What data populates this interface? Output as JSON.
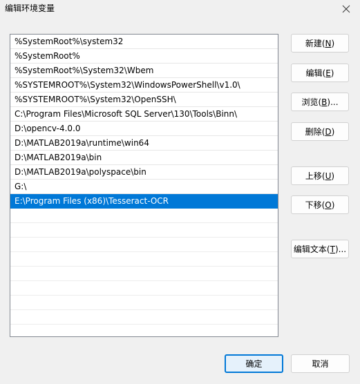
{
  "window": {
    "title": "编辑环境变量"
  },
  "path_list": {
    "items": [
      "%SystemRoot%\\system32",
      "%SystemRoot%",
      "%SystemRoot%\\System32\\Wbem",
      "%SYSTEMROOT%\\System32\\WindowsPowerShell\\v1.0\\",
      "%SYSTEMROOT%\\System32\\OpenSSH\\",
      "C:\\Program Files\\Microsoft SQL Server\\130\\Tools\\Binn\\",
      "D:\\opencv-4.0.0",
      "D:\\MATLAB2019a\\runtime\\win64",
      "D:\\MATLAB2019a\\bin",
      "D:\\MATLAB2019a\\polyspace\\bin",
      "G:\\",
      "E:\\Program Files (x86)\\Tesseract-OCR"
    ],
    "selected_index": 11
  },
  "buttons": {
    "new": {
      "label": "新建",
      "key": "N"
    },
    "edit": {
      "label": "编辑",
      "key": "E"
    },
    "browse": {
      "label": "浏览",
      "key": "B",
      "suffix": "..."
    },
    "delete": {
      "label": "删除",
      "key": "D"
    },
    "move_up": {
      "label": "上移",
      "key": "U"
    },
    "move_down": {
      "label": "下移",
      "key": "O"
    },
    "edit_text": {
      "label": "编辑文本",
      "key": "T",
      "suffix": "..."
    },
    "ok": "确定",
    "cancel": "取消"
  },
  "colors": {
    "selection": "#0078d7",
    "window_bg": "#f0f0f0",
    "list_bg": "#ffffff"
  },
  "icons": {
    "close": "close-icon"
  }
}
